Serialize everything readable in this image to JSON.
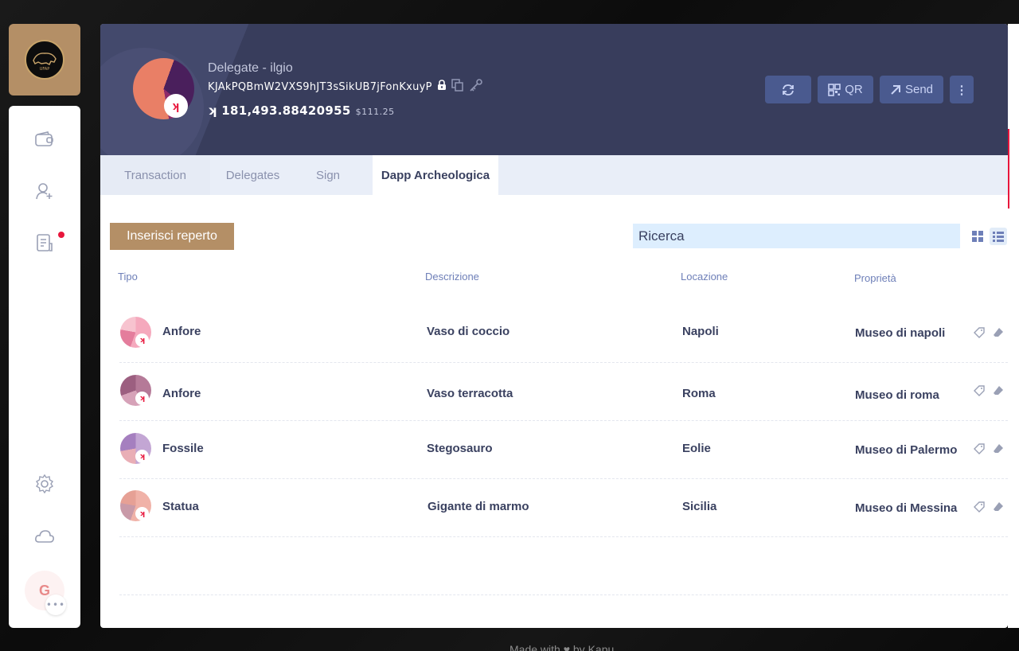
{
  "logo": {
    "text": "UFAP"
  },
  "sidebar": {
    "items": [
      {
        "icon": "wallet-icon"
      },
      {
        "icon": "add-user-icon"
      },
      {
        "icon": "document-icon",
        "notification": true
      },
      {
        "icon": "gear-icon"
      },
      {
        "icon": "cloud-icon"
      }
    ],
    "avatar_letter": "G",
    "more": "•••"
  },
  "account": {
    "name": "Delegate - ilgio",
    "address": "KJAkPQBmW2VXS9hJT3sSikUB7jFonKxuyP",
    "balance_symbol": "ʞ",
    "balance": "181,493.88420955",
    "fiat": "$111.25",
    "badge": "ʞ"
  },
  "header_buttons": {
    "refresh": "",
    "qr": "QR",
    "send": "Send",
    "more": "⋮"
  },
  "tabs": [
    "Transaction",
    "Delegates",
    "Sign",
    "Dapp Archeologica"
  ],
  "active_tab": "Dapp Archeologica",
  "toolbar": {
    "insert_label": "Inserisci reperto",
    "search_value": "Ricerca"
  },
  "table": {
    "headers": [
      "Tipo",
      "Descrizione",
      "Locazione",
      "Proprietà"
    ],
    "rows": [
      {
        "tipo": "Anfore",
        "descrizione": "Vaso di coccio",
        "locazione": "Napoli",
        "proprieta": "Museo di napoli"
      },
      {
        "tipo": "Anfore",
        "descrizione": "Vaso terracotta",
        "locazione": "Roma",
        "proprieta": "Museo di roma"
      },
      {
        "tipo": "Fossile",
        "descrizione": "Stegosauro",
        "locazione": "Eolie",
        "proprieta": "Museo di Palermo"
      },
      {
        "tipo": "Statua",
        "descrizione": "Gigante di marmo",
        "locazione": "Sicilia",
        "proprieta": "Museo di Messina"
      }
    ]
  },
  "footer": "Made with ♥ by Kapu",
  "colors": {
    "header_bg": "#383d5c",
    "accent_gold": "#b48f66",
    "accent_red": "#e8163c",
    "button_bg": "#4a5a8f"
  }
}
